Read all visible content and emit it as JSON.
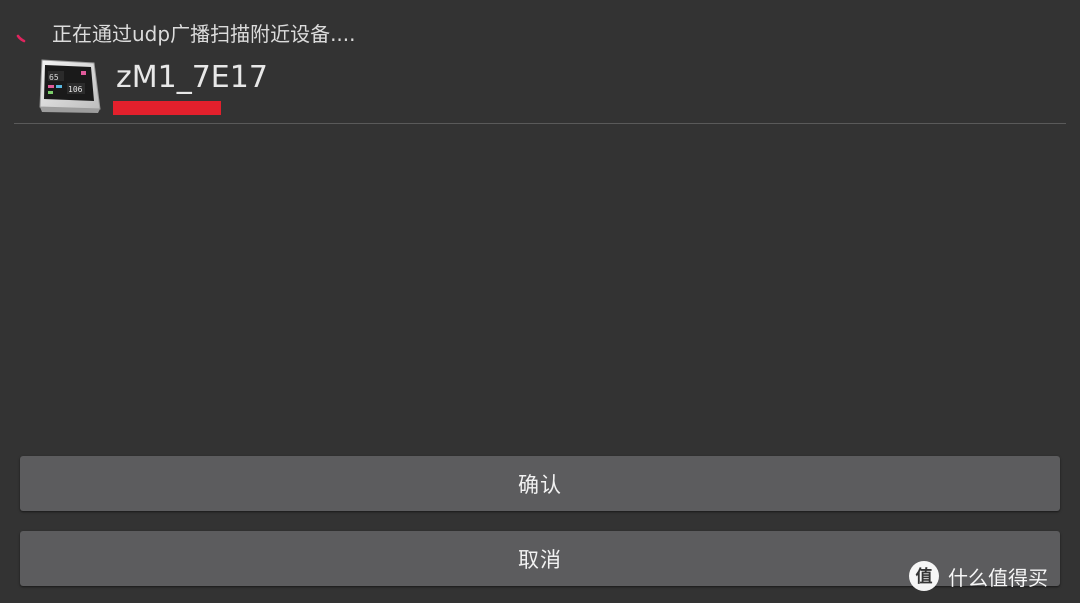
{
  "dialog": {
    "scan_status": "正在通过udp广播扫描附近设备....",
    "device": {
      "name": "zM1_7E17",
      "thumbnail_icon": "air-quality-monitor-icon"
    },
    "confirm_label": "确认",
    "cancel_label": "取消"
  },
  "watermark": {
    "text": "什么值得买",
    "logo_icon": "zhi-logo-icon"
  },
  "colors": {
    "background": "#333333",
    "button": "#5c5c5e",
    "spinner": "#e0245e",
    "redaction": "#e3202c"
  }
}
